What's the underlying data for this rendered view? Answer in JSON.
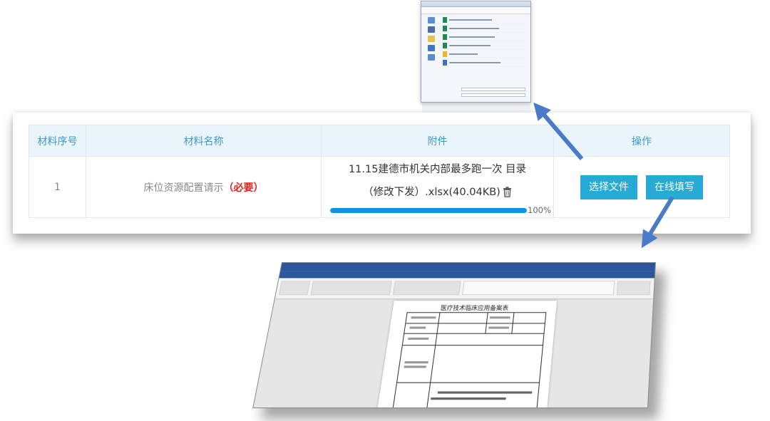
{
  "table": {
    "headers": [
      "材料序号",
      "材料名称",
      "附件",
      "操作"
    ],
    "rows": [
      {
        "index": "1",
        "name": "床位资源配置请示",
        "required": "（必要）",
        "attachment_name": "11.15建德市机关内部最多跑一次 目录（修改下发）.xlsx(40.04KB)",
        "progress_percent": 100,
        "progress_label": "100%"
      }
    ]
  },
  "actions": {
    "select_file_label": "选择文件",
    "online_fill_label": "在线填写"
  },
  "doc_preview": {
    "heading": "医疗技术临床应用备案表"
  },
  "colors": {
    "header_bg": "#e9f4fb",
    "header_text": "#3f9ac9",
    "button": "#26abd4",
    "required": "#e8221b",
    "progress": "#1591e3",
    "arrow": "#4a7bc8"
  },
  "icons": {
    "delete": "trash-icon"
  }
}
